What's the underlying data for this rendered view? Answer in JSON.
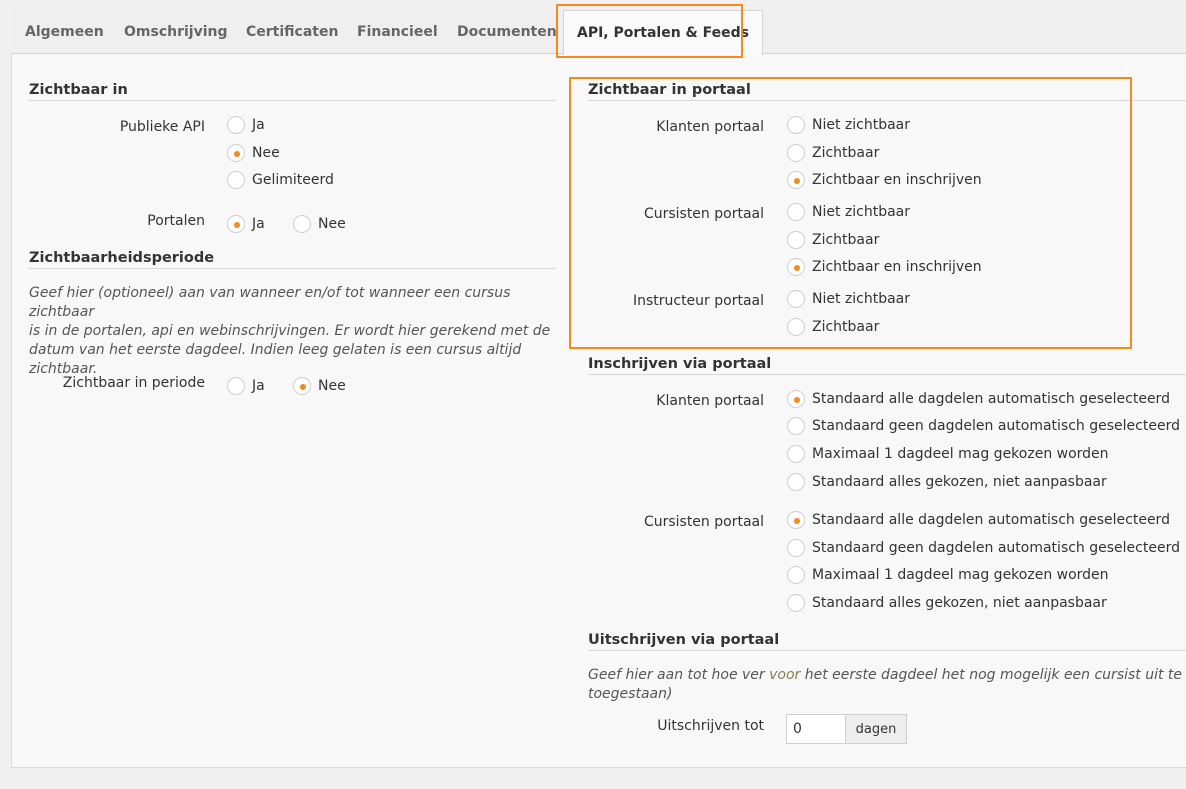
{
  "tabs": [
    "Algemeen",
    "Omschrijving",
    "Certificaten",
    "Financieel",
    "Documenten",
    "API, Portalen & Feeds"
  ],
  "accent": "#f28a1c",
  "left": {
    "zichtbaar_in": {
      "title": "Zichtbaar in",
      "publieke_api": {
        "label": "Publieke API",
        "options": [
          "Ja",
          "Nee",
          "Gelimiteerd"
        ],
        "selected": "Nee"
      },
      "portalen": {
        "label": "Portalen",
        "options": [
          "Ja",
          "Nee"
        ],
        "selected": "Ja"
      }
    },
    "periode": {
      "title": "Zichtbaarheidsperiode",
      "description": "Geef hier (optioneel) aan van wanneer en/of tot wanneer een cursus zichtbaar is in de portalen, api en webinschrijvingen. Er wordt hier gerekend met de datum van het eerste dagdeel. Indien leeg gelaten is een cursus altijd zichtbaar.",
      "desc_lines": [
        "Geef hier (optioneel) aan van wanneer en/of tot wanneer een cursus zichtbaar",
        "is in de portalen, api en webinschrijvingen. Er wordt hier gerekend met de",
        "datum van het eerste dagdeel. Indien leeg gelaten is een cursus altijd",
        "zichtbaar."
      ],
      "field": {
        "label": "Zichtbaar in periode",
        "options": [
          "Ja",
          "Nee"
        ],
        "selected": "Nee"
      }
    }
  },
  "right": {
    "zichtbaar_portaal": {
      "title": "Zichtbaar in portaal",
      "klanten": {
        "label": "Klanten portaal",
        "options": [
          "Niet zichtbaar",
          "Zichtbaar",
          "Zichtbaar en inschrijven"
        ],
        "selected": "Zichtbaar en inschrijven"
      },
      "cursisten": {
        "label": "Cursisten portaal",
        "options": [
          "Niet zichtbaar",
          "Zichtbaar",
          "Zichtbaar en inschrijven"
        ],
        "selected": "Zichtbaar en inschrijven"
      },
      "instructeur": {
        "label": "Instructeur portaal",
        "options": [
          "Niet zichtbaar",
          "Zichtbaar"
        ],
        "selected": ""
      }
    },
    "inschrijven": {
      "title": "Inschrijven via portaal",
      "klanten": {
        "label": "Klanten portaal",
        "options": [
          "Standaard alle dagdelen automatisch geselecteerd",
          "Standaard geen dagdelen automatisch geselecteerd",
          "Maximaal 1 dagdeel mag gekozen worden",
          "Standaard alles gekozen, niet aanpasbaar"
        ],
        "selected": "Standaard alle dagdelen automatisch geselecteerd"
      },
      "cursisten": {
        "label": "Cursisten portaal",
        "options": [
          "Standaard alle dagdelen automatisch geselecteerd",
          "Standaard geen dagdelen automatisch geselecteerd",
          "Maximaal 1 dagdeel mag gekozen worden",
          "Standaard alles gekozen, niet aanpasbaar"
        ],
        "selected": "Standaard alle dagdelen automatisch geselecteerd"
      }
    },
    "uitschrijven": {
      "title": "Uitschrijven via portaal",
      "desc_pre": "Geef hier aan tot hoe ver ",
      "desc_hl": "voor",
      "desc_post": " het eerste dagdeel het nog mogelijk een cursist uit te schrij",
      "desc_line2": "toegestaan)",
      "field": {
        "label": "Uitschrijven tot",
        "value": "0",
        "unit": "dagen"
      }
    }
  }
}
